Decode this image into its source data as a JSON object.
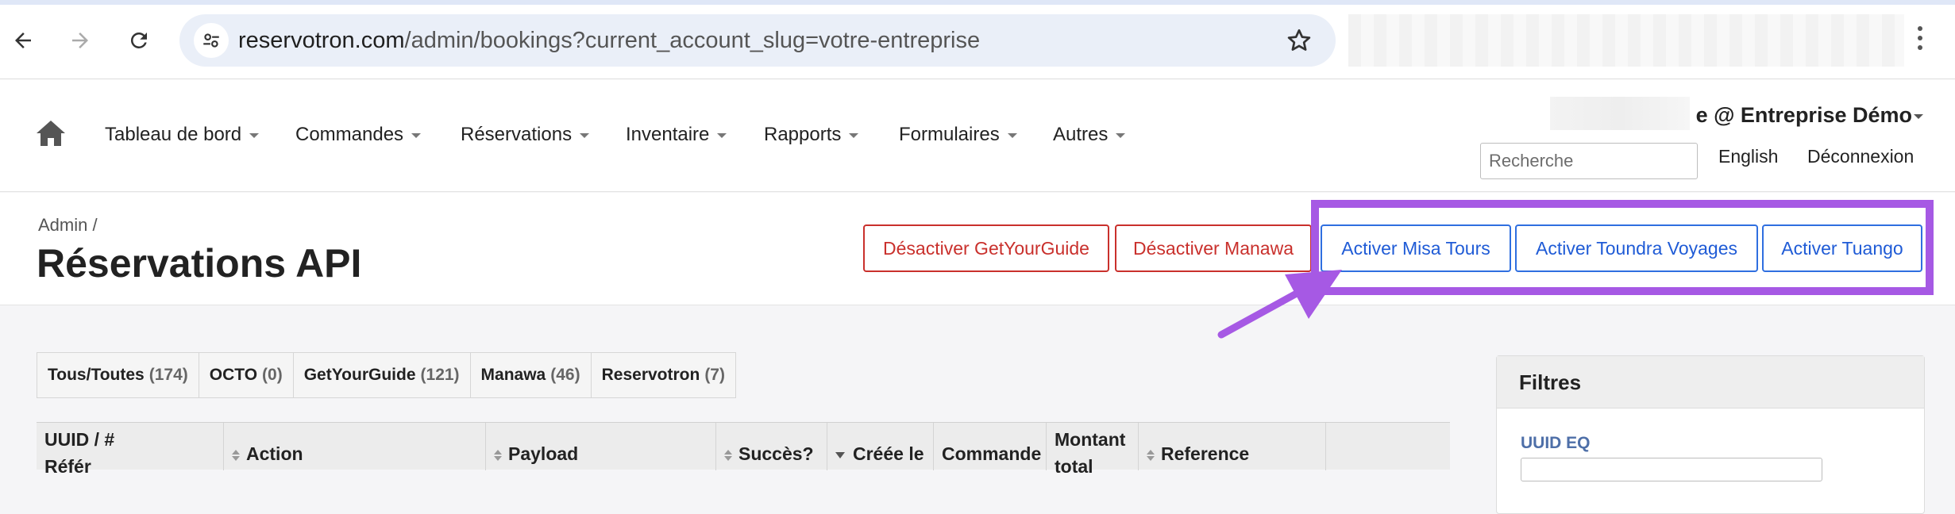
{
  "browser": {
    "url_host": "reservotron.com",
    "url_path": "/admin/bookings?current_account_slug=votre-entreprise"
  },
  "nav": {
    "items": [
      {
        "label": "Tableau de bord"
      },
      {
        "label": "Commandes"
      },
      {
        "label": "Réservations"
      },
      {
        "label": "Inventaire"
      },
      {
        "label": "Rapports"
      },
      {
        "label": "Formulaires"
      },
      {
        "label": "Autres"
      }
    ],
    "user": "e @ Entreprise Démo",
    "search_placeholder": "Recherche",
    "language": "English",
    "logout": "Déconnexion"
  },
  "page": {
    "breadcrumb": "Admin  /",
    "title": "Réservations API",
    "actions": [
      {
        "label": "Désactiver GetYourGuide",
        "style": "danger"
      },
      {
        "label": "Désactiver Manawa",
        "style": "danger"
      },
      {
        "label": "Activer Misa Tours",
        "style": "primary"
      },
      {
        "label": "Activer Toundra Voyages",
        "style": "primary"
      },
      {
        "label": "Activer Tuango",
        "style": "primary"
      }
    ]
  },
  "tabs": [
    {
      "label": "Tous/Toutes",
      "count": "(174)"
    },
    {
      "label": "OCTO",
      "count": "(0)"
    },
    {
      "label": "GetYourGuide",
      "count": "(121)"
    },
    {
      "label": "Manawa",
      "count": "(46)"
    },
    {
      "label": "Reservotron",
      "count": "(7)"
    }
  ],
  "table": {
    "columns": [
      {
        "line1": "UUID / #",
        "line2": "Référ"
      },
      {
        "label": "Action"
      },
      {
        "label": "Payload"
      },
      {
        "label": "Succès?"
      },
      {
        "label": "Créée le"
      },
      {
        "label": "Commande"
      },
      {
        "line1": "Montant",
        "line2": "total"
      },
      {
        "label": "Reference"
      }
    ]
  },
  "filters": {
    "title": "Filtres",
    "uuid_label": "UUID EQ"
  },
  "colors": {
    "danger": "#c9302c",
    "primary": "#1f5bd6",
    "highlight": "#a659e4"
  }
}
